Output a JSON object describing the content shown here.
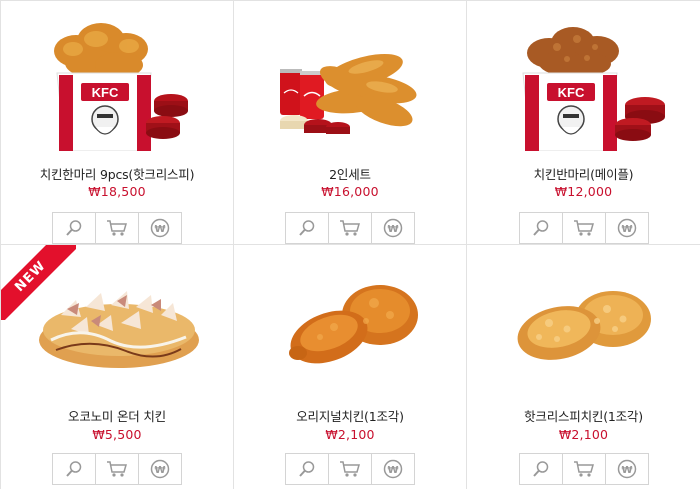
{
  "products": [
    {
      "name": "치킨한마리 9pcs(핫크리스피)",
      "price": "₩18,500",
      "image": "kfc-bucket-crispy-with-sauces"
    },
    {
      "name": "2인세트",
      "price": "₩16,000",
      "image": "tenders-with-cola-set"
    },
    {
      "name": "치킨반마리(메이플)",
      "price": "₩12,000",
      "image": "kfc-bucket-maple-with-sauces"
    },
    {
      "name": "오코노미 온더 치킨",
      "price": "₩5,500",
      "image": "okonomi-topped-chicken",
      "badge": "NEW"
    },
    {
      "name": "오리지널치킨(1조각)",
      "price": "₩2,100",
      "image": "original-chicken-pieces"
    },
    {
      "name": "핫크리스피치킨(1조각)",
      "price": "₩2,100",
      "image": "hot-crispy-chicken-pieces"
    }
  ],
  "actions": [
    {
      "icon": "magnifier-icon",
      "label": "상세보기"
    },
    {
      "icon": "cart-icon",
      "label": "장바구니"
    },
    {
      "icon": "won-coin-icon",
      "label": "바로구매"
    }
  ],
  "colors": {
    "price": "#c8102e",
    "badge": "#e3102c",
    "kfc_red": "#c8102e"
  }
}
